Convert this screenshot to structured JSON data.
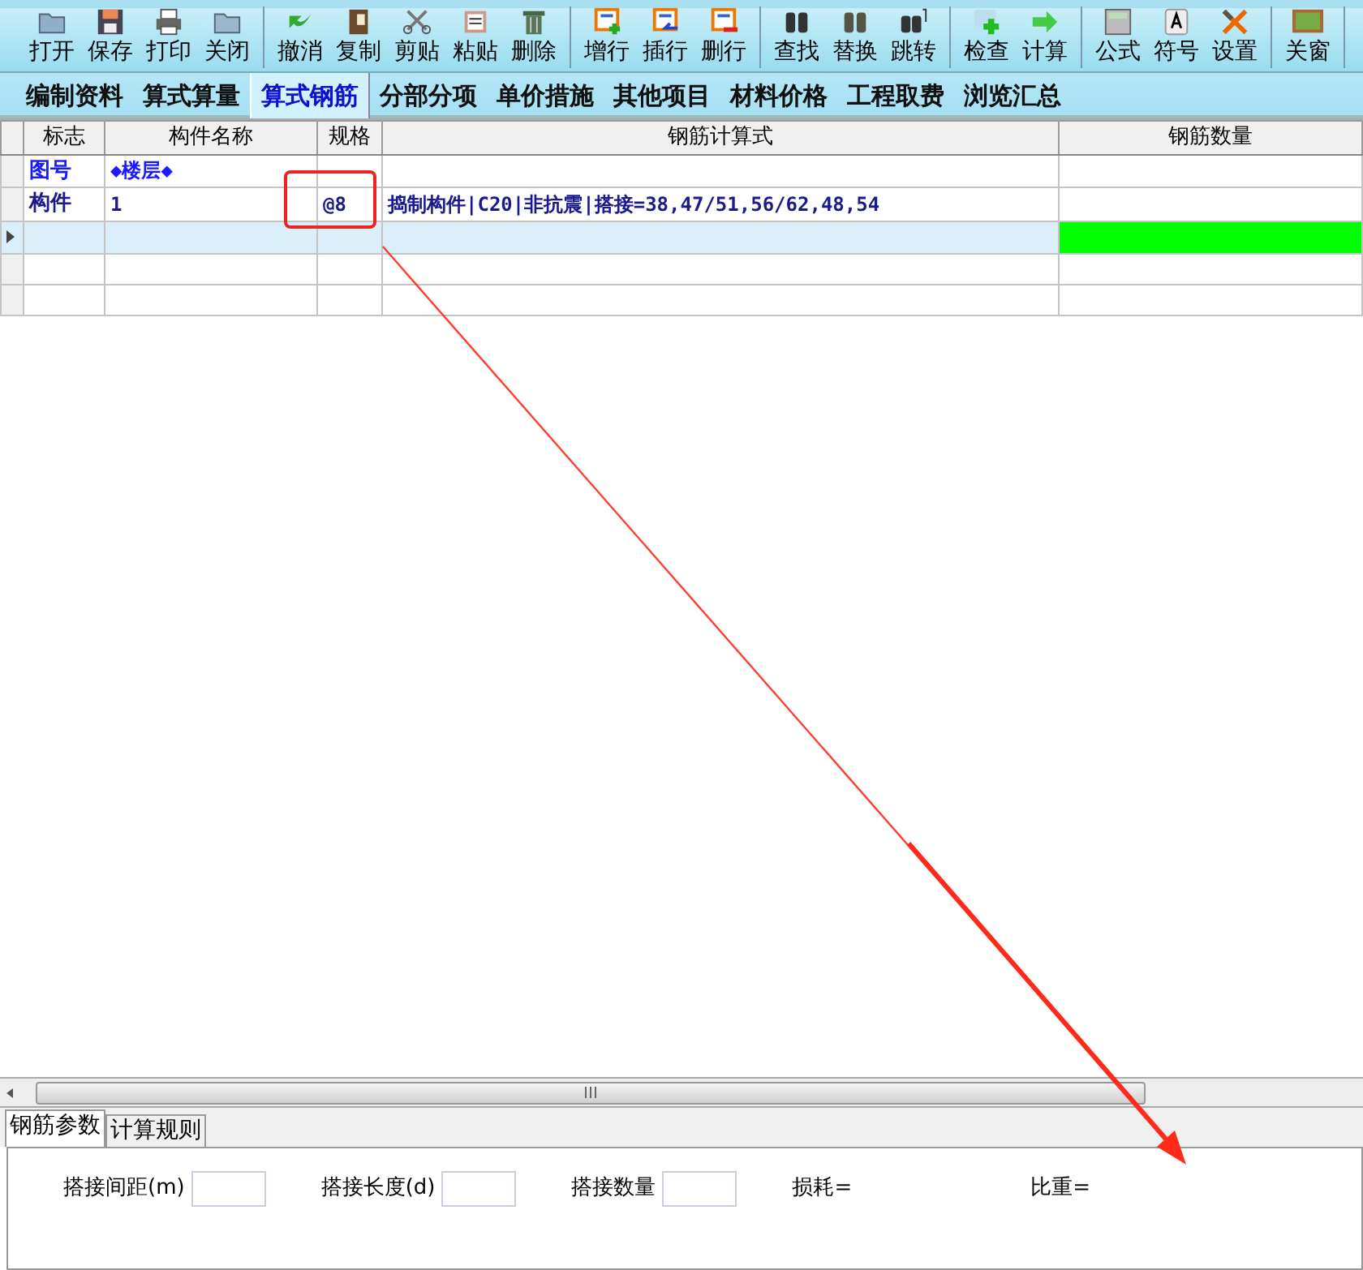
{
  "toolbar": [
    [
      {
        "label": "打开"
      },
      {
        "label": "保存"
      },
      {
        "label": "打印"
      },
      {
        "label": "关闭"
      }
    ],
    [
      {
        "label": "撤消"
      },
      {
        "label": "复制"
      },
      {
        "label": "剪贴"
      },
      {
        "label": "粘贴"
      },
      {
        "label": "删除"
      }
    ],
    [
      {
        "label": "增行"
      },
      {
        "label": "插行"
      },
      {
        "label": "删行"
      }
    ],
    [
      {
        "label": "查找"
      },
      {
        "label": "替换"
      },
      {
        "label": "跳转"
      }
    ],
    [
      {
        "label": "检查"
      },
      {
        "label": "计算"
      }
    ],
    [
      {
        "label": "公式"
      },
      {
        "label": "符号"
      },
      {
        "label": "设置"
      }
    ],
    [
      {
        "label": "关窗"
      }
    ]
  ],
  "tabs": [
    {
      "label": "编制资料",
      "selected": false
    },
    {
      "label": "算式算量",
      "selected": false
    },
    {
      "label": "算式钢筋",
      "selected": true
    },
    {
      "label": "分部分项",
      "selected": false
    },
    {
      "label": "单价措施",
      "selected": false
    },
    {
      "label": "其他项目",
      "selected": false
    },
    {
      "label": "材料价格",
      "selected": false
    },
    {
      "label": "工程取费",
      "selected": false
    },
    {
      "label": "浏览汇总",
      "selected": false
    }
  ],
  "table": {
    "columns": [
      "标志",
      "构件名称",
      "规格",
      "钢筋计算式",
      "钢筋数量"
    ],
    "rows": [
      {
        "kind": "drawing-number",
        "selected": false,
        "editing": false,
        "cells": [
          "图号",
          "◆楼层◆"
        ]
      },
      {
        "kind": "component",
        "selected": false,
        "editing": false,
        "cells": [
          "构件",
          "1",
          "@8",
          "捣制构件|C20|非抗震|搭接=38,47/51,56/62,48,54"
        ]
      },
      {
        "kind": "component",
        "selected": true,
        "editing": true,
        "cells": []
      },
      {
        "kind": "component",
        "selected": false,
        "editing": false,
        "cells": []
      },
      {
        "kind": "component",
        "selected": false,
        "editing": false,
        "cells": []
      }
    ]
  },
  "bottom_tabs": [
    {
      "label": "钢筋参数",
      "selected": true
    },
    {
      "label": "计算规则",
      "selected": false
    }
  ],
  "params": [
    {
      "kind": "field",
      "label": "搭接间距(m)"
    },
    {
      "kind": "field",
      "label": "搭接长度(d)"
    },
    {
      "kind": "field",
      "label": "搭接数量"
    },
    {
      "kind": "text",
      "label": "损耗="
    },
    {
      "kind": "text",
      "label": "比重="
    }
  ]
}
